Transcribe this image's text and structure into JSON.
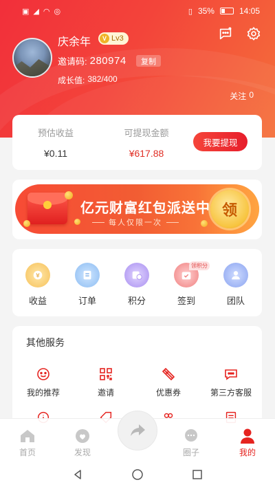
{
  "status_bar": {
    "left_icons": [
      "sim-icon",
      "signal-icon",
      "wifi-icon",
      "alarm-icon"
    ],
    "battery": "35%",
    "time": "14:05",
    "right_icons": [
      "vibrate-icon",
      "battery-icon"
    ]
  },
  "profile": {
    "username": "庆余年",
    "level": "Lv3",
    "level_badge": "V",
    "invite_label": "邀请码:",
    "invite_code": "280974",
    "copy_label": "复制",
    "growth_label": "成长值:",
    "growth_value": "382/400",
    "follow_label": "关注",
    "follow_count": "0"
  },
  "earnings": {
    "estimated_label": "预估收益",
    "estimated_value": "¥0.11",
    "withdrawable_label": "可提现金额",
    "withdrawable_value": "¥617.88",
    "withdraw_button": "我要提现"
  },
  "banner": {
    "title": "亿元财富红包派送中",
    "subtitle": "每人仅限一次",
    "claim_label": "领"
  },
  "menu": {
    "items": [
      {
        "label": "收益",
        "icon": "earnings-icon"
      },
      {
        "label": "订单",
        "icon": "orders-icon"
      },
      {
        "label": "积分",
        "icon": "points-icon"
      },
      {
        "label": "签到",
        "icon": "checkin-icon",
        "tag": "领积分"
      },
      {
        "label": "团队",
        "icon": "team-icon"
      }
    ]
  },
  "services": {
    "title": "其他服务",
    "items": [
      {
        "label": "我的推荐",
        "icon": "recommend-icon"
      },
      {
        "label": "邀请",
        "icon": "qrcode-icon"
      },
      {
        "label": "优惠券",
        "icon": "coupon-icon"
      },
      {
        "label": "第三方客服",
        "icon": "customer-service-icon"
      }
    ]
  },
  "tabbar": {
    "items": [
      {
        "label": "首页",
        "icon": "home-icon"
      },
      {
        "label": "发现",
        "icon": "discover-icon"
      },
      {
        "label": "",
        "icon": "share-icon"
      },
      {
        "label": "圈子",
        "icon": "circle-icon"
      },
      {
        "label": "我的",
        "icon": "profile-icon"
      }
    ]
  },
  "colors": {
    "brand_red": "#e5231f",
    "header_gradient_start": "#f22f3a",
    "header_gradient_end": "#f5703a",
    "price_red": "#e02e24"
  }
}
